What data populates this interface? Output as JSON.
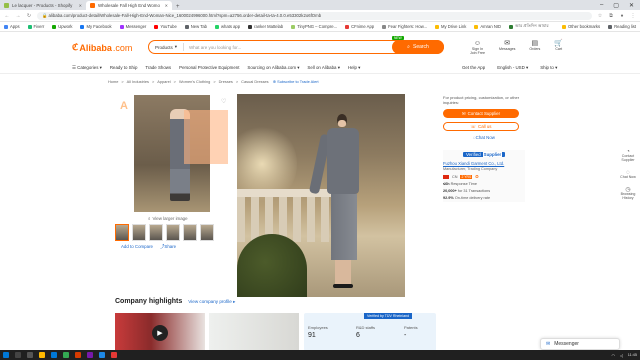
{
  "browser": {
    "tabs": [
      {
        "label": "Le lacquer - Products - Shopify"
      },
      {
        "label": "Wholesale Fall High End Womo"
      }
    ],
    "url": "alibaba.com/product-detail/Wholesale-Fall-High-End-Woman-Nice_1600024996000.html?spm=a2756.order-detail-ta-ta-4.0.0.e53302k2o6fOmb",
    "bookmarks": [
      "Apps",
      "Fiverr",
      "Upwork",
      "My Facebook",
      "Messenger",
      "YouTube",
      "New Tab",
      "whats app",
      "ranker Mattelab",
      "TinyPNG – Compre...",
      "CFnime App",
      "Fear Fighters: How...",
      "My Drive Link",
      "Amran NID",
      "আর প্রতিদিন আমার"
    ],
    "bookmarks_right": [
      "Other bookmarks",
      "Reading list"
    ]
  },
  "header": {
    "logo": "Alibaba",
    "logo_suffix": ".com",
    "search_category": "Products",
    "search_placeholder": "What are you looking for...",
    "search_button": "Search",
    "new_badge": "NEW",
    "icons": [
      {
        "name": "account",
        "glyph": "☺",
        "label": "Sign In\nJoin Free"
      },
      {
        "name": "messages",
        "glyph": "✉",
        "label": "Messages"
      },
      {
        "name": "orders",
        "glyph": "▤",
        "label": "Orders"
      },
      {
        "name": "cart",
        "glyph": "🛒",
        "label": "Cart"
      }
    ]
  },
  "catnav": {
    "left": [
      "☰ Categories ▾",
      "Ready to Ship",
      "Trade Shows",
      "Personal Protective Equipment",
      "Sourcing on Alibaba.com ▾",
      "Sell on Alibaba ▾",
      "Help ▾"
    ],
    "right": [
      "Get the App",
      "English - USD ▾",
      "Ship to ▾"
    ]
  },
  "breadcrumb": {
    "items": [
      "Home",
      "All Industries",
      "Apparel",
      "Women's Clothing",
      "Dresses",
      "Casual Dresses"
    ],
    "trade_alert": "Subscribe to Trade Alert"
  },
  "gallery": {
    "view_larger": "View larger image",
    "add_compare": "Add to Compare",
    "share": "Share",
    "ghost_text": "A"
  },
  "buybox": {
    "note": "For product pricing, customization, or other inquiries:",
    "contact_supplier": "Contact Supplier",
    "call_us": "Call us",
    "chat_now": "Chat Now"
  },
  "supplier": {
    "verified": "Verified",
    "verified_suffix": "Supplier",
    "name": "Fuzhou Xiandi Garment Co., Ltd.",
    "type": "Manufacturer, Trading Company",
    "country": "CN",
    "years": "2 YRS",
    "response_time_value": "≤6h",
    "response_time_label": "Response Time",
    "transactions_value": "20,000+",
    "transactions_label": "for 31 Transactions",
    "ontime_value": "92.9%",
    "ontime_label": "On-time delivery rate"
  },
  "right_sidebar": [
    {
      "glyph": "◔",
      "label": "Contact Supplier"
    },
    {
      "glyph": "◌",
      "label": "Chat Now"
    },
    {
      "glyph": "◷",
      "label": "Browsing History"
    }
  ],
  "company": {
    "title": "Company highlights",
    "view_profile": "View company profile ▸",
    "tuv": "Verified by TÜV Rheinland",
    "employees_label": "Employees",
    "employees_value": "91",
    "rnd_label": "R&D staffs",
    "rnd_value": "6",
    "patents_label": "Patents",
    "patents_value": "-"
  },
  "messenger": {
    "label": "Messenger"
  },
  "taskbar": {
    "time": "11:45"
  },
  "colors": {
    "accent": "#ff6a00",
    "link": "#1a66c8"
  }
}
